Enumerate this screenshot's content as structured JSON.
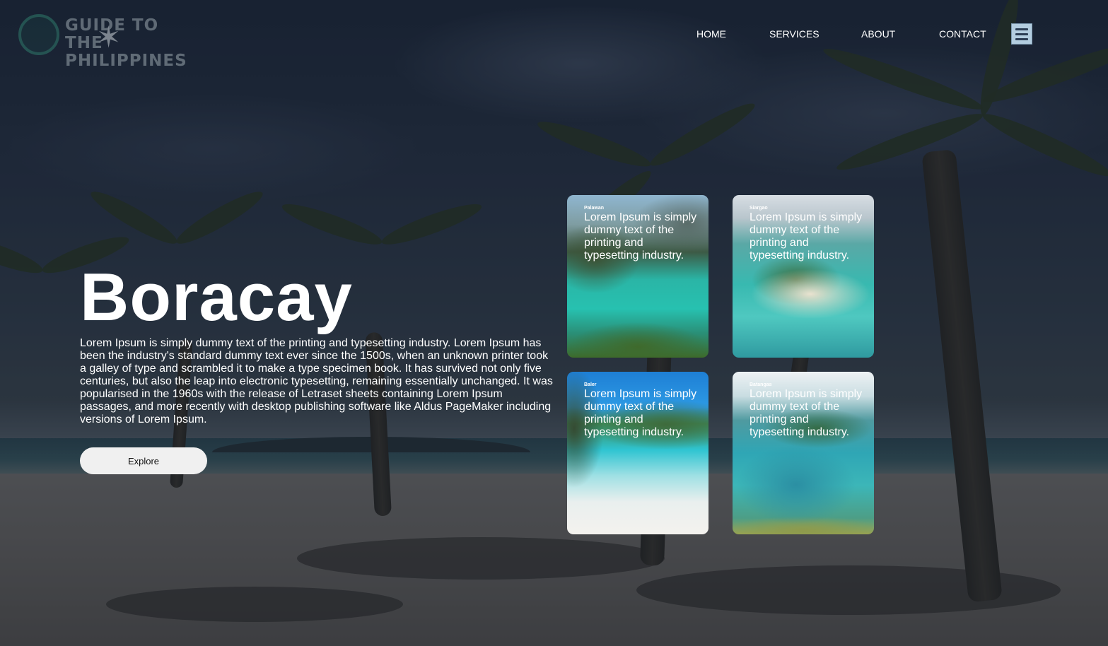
{
  "header": {
    "logo_text": "GUIDE TO THE PHILIPPINES",
    "nav": [
      {
        "label": "HOME"
      },
      {
        "label": "SERVICES"
      },
      {
        "label": "ABOUT"
      },
      {
        "label": "CONTACT"
      }
    ],
    "menu_icon": "hamburger-menu-icon"
  },
  "hero": {
    "title": "Boracay",
    "text": "Lorem Ipsum is simply dummy text of the printing and typesetting industry. Lorem Ipsum has been the industry's standard dummy text ever since the 1500s, when an unknown printer took a galley of type and scrambled it to make a type specimen book. It has survived not only five centuries, but also the leap into electronic typesetting, remaining essentially unchanged. It was popularised in the 1960s with the release of Letraset sheets containing Lorem Ipsum passages, and more recently with desktop publishing software like Aldus PageMaker including versions of Lorem Ipsum.",
    "button_label": "Explore"
  },
  "cards": [
    {
      "place": "Palawan",
      "text": "Lorem Ipsum is simply dummy text of the printing and typesetting industry."
    },
    {
      "place": "Siargao",
      "text": "Lorem Ipsum is simply dummy text of the printing and typesetting industry."
    },
    {
      "place": "Baler",
      "text": "Lorem Ipsum is simply dummy text of the printing and typesetting industry."
    },
    {
      "place": "Batangas",
      "text": "Lorem Ipsum is simply dummy text of the printing and typesetting industry."
    }
  ]
}
